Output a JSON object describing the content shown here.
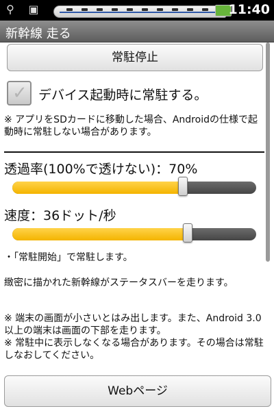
{
  "status_bar": {
    "clock": "11:40",
    "usb_icon": "usb-icon",
    "android_icon": "android-icon",
    "battery_color": "#67b43b"
  },
  "title_bar": {
    "title": "新幹線 走る"
  },
  "buttons": {
    "stop": "常駐停止",
    "web": "Webページ"
  },
  "settings": {
    "startup_checkbox": {
      "label": "デバイス起動時に常駐する。",
      "checked": false
    },
    "note_sd": "※ アプリをSDカードに移動した場合、Androidの仕様で起動時に常駐しない場合があります。",
    "transparency": {
      "label": "透過率(100%で透けない)：70%",
      "value_percent": 70
    },
    "speed": {
      "label": "速度：36ドット/秒",
      "value_fraction": 0.72
    },
    "start_hint": "・「常駐開始」で常駐します。"
  },
  "description": {
    "paragraph1": "緻密に描かれた新幹線がステータスバーを走ります。",
    "paragraph2": "※ 端末の画面が小さいとはみ出します。また、Android 3.0以上の端末は画面の下部を走ります。",
    "paragraph3": "※ 常駐中に表示しなくなる場合があります。その場合は常駐しなおしてください。"
  },
  "accent_color": "#f4b400"
}
